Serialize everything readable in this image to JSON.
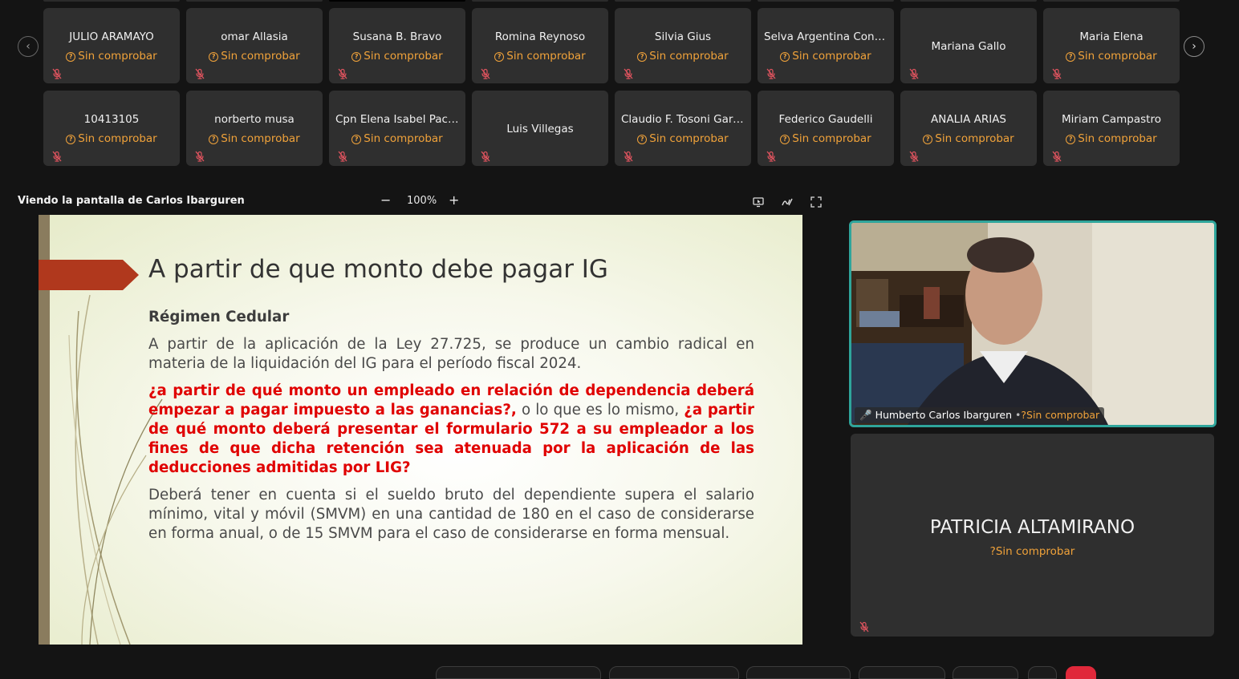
{
  "participants_row1": [
    {
      "name": "JULIO ARAMAYO",
      "status": "Sin comprobar"
    },
    {
      "name": "omar Allasia",
      "status": "Sin comprobar"
    },
    {
      "name": "Susana B. Bravo",
      "status": "Sin comprobar"
    },
    {
      "name": "Romina Reynoso",
      "status": "Sin comprobar"
    },
    {
      "name": "Silvia Gius",
      "status": "Sin comprobar"
    },
    {
      "name": "Selva Argentina Contre...",
      "status": "Sin comprobar"
    },
    {
      "name": "Mariana Gallo",
      "status": ""
    },
    {
      "name": "Maria Elena",
      "status": "Sin comprobar"
    }
  ],
  "participants_row2": [
    {
      "name": "10413105",
      "status": "Sin comprobar"
    },
    {
      "name": "norberto musa",
      "status": "Sin comprobar"
    },
    {
      "name": "Cpn Elena Isabel Pachao",
      "status": "Sin comprobar"
    },
    {
      "name": "Luis Villegas",
      "status": ""
    },
    {
      "name": "Claudio F. Tosoni Garcia",
      "status": "Sin comprobar"
    },
    {
      "name": "Federico Gaudelli",
      "status": "Sin comprobar"
    },
    {
      "name": "ANALIA ARIAS",
      "status": "Sin comprobar"
    },
    {
      "name": "Miriam Campastro",
      "status": "Sin comprobar"
    }
  ],
  "share": {
    "label": "Viendo la pantalla de Carlos Ibarguren",
    "zoom": "100%",
    "zoom_out": "−",
    "zoom_in": "+"
  },
  "slide": {
    "title": "A partir de que monto debe pagar IG",
    "subtitle": "Régimen Cedular",
    "p1": "A partir de la aplicación de la Ley 27.725, se produce un cambio radical en materia de la liquidación del IG para el período fiscal 2024.",
    "q1": "¿a partir de qué monto un empleado en relación de dependencia deberá empezar a pagar impuesto a las ganancias?,",
    "q_mid": " o lo que es lo mismo, ",
    "q2": "¿a partir de qué monto deberá presentar el formulario 572 a su empleador a los fines de que dicha retención sea atenuada por la aplicación de las deducciones admitidas por LIG?",
    "p3": "Deberá tener en cuenta si el sueldo bruto del dependiente supera el salario mínimo, vital y móvil (SMVM) en una cantidad de 180 en el caso de considerarse en forma anual, o de 15 SMVM para el caso de considerarse en forma mensual."
  },
  "speaker": {
    "name": "Humberto Carlos Ibarguren",
    "sep": "•",
    "status": "Sin comprobar"
  },
  "participant_big": {
    "name": "PATRICIA ALTAMIRANO",
    "status": "Sin comprobar"
  },
  "colors": {
    "accent_teal": "#2fa59b",
    "status_orange": "#f0a23a",
    "slide_red": "#e00000",
    "flag_red": "#b0381d"
  }
}
